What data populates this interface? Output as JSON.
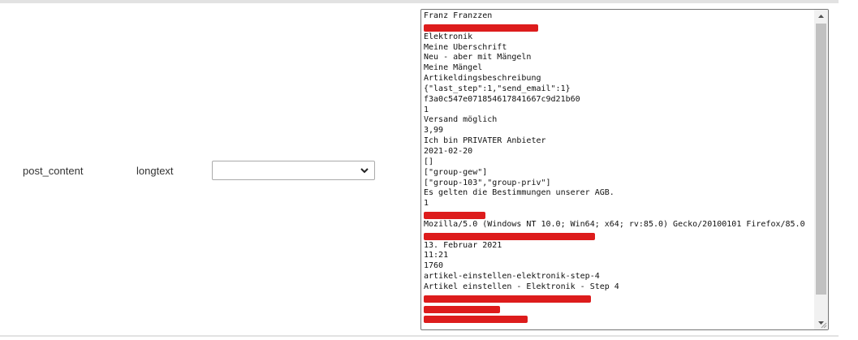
{
  "row": {
    "field_name": "post_content",
    "field_type": "longtext",
    "select": {
      "value": ""
    }
  },
  "textarea": {
    "scroll_position": 0.0,
    "lines": [
      "Franz Franzzen",
      "",
      "Elektronik",
      "Meine Überschrift",
      "Neu - aber mit Mängeln",
      "Meine Mängel",
      "Artikeldingsbeschreibung",
      "{\"last_step\":1,\"send_email\":1}",
      "f3a0c547e071854617841667c9d21b60",
      "1",
      "Versand möglich",
      "3,99",
      "Ich bin PRIVATER Anbieter",
      "2021-02-20",
      "[]",
      "[\"group-gew\"]",
      "[\"group-103\",\"group-priv\"]",
      "Es gelten die Bestimmungen unserer AGB.",
      "1",
      "",
      "Mozilla/5.0 (Windows NT 10.0; Win64; x64; rv:85.0) Gecko/20100101 Firefox/85.0",
      "",
      "13. Februar 2021",
      "11:21",
      "1760",
      "artikel-einstellen-elektronik-step-4",
      "Artikel einstellen - Elektronik - Step 4",
      "",
      "",
      ""
    ],
    "redaction_color": "#dd1c1c"
  }
}
